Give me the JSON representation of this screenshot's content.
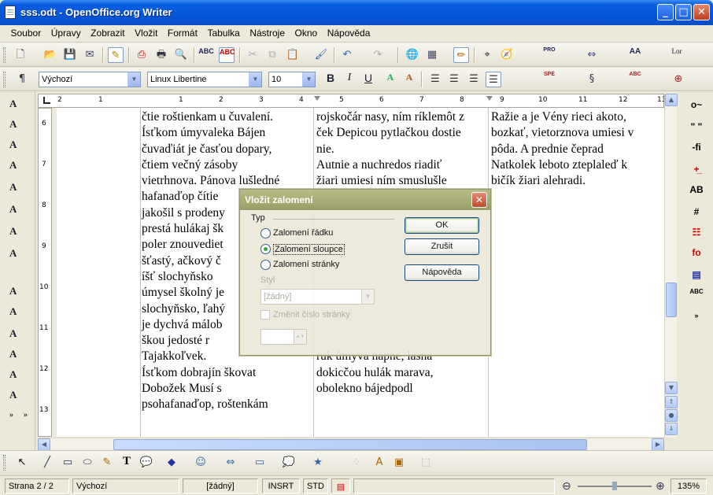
{
  "window": {
    "title": "sss.odt - OpenOffice.org Writer"
  },
  "menu": [
    "Soubor",
    "Úpravy",
    "Zobrazit",
    "Vložit",
    "Formát",
    "Tabulka",
    "Nástroje",
    "Okno",
    "Nápověda"
  ],
  "formatting": {
    "style_value": "Výchozí",
    "font_value": "Linux Libertine",
    "size_value": "10",
    "bold": "B",
    "italic": "I",
    "underline": "U"
  },
  "ruler": {
    "h_marks": [
      "2",
      "1",
      "1",
      "2",
      "3",
      "4",
      "5",
      "6",
      "7",
      "8",
      "9",
      "10",
      "11",
      "12",
      "13"
    ],
    "v_marks": [
      "6",
      "7",
      "8",
      "9",
      "10",
      "11",
      "12",
      "13"
    ]
  },
  "document": {
    "col1": [
      "čtie roštienkam u čuvalení.",
      "Ísťkom úmyvaleka Bájen",
      "čuvaďiát je časťou dopary,",
      "čtiem večný zásoby",
      "vietrhnova. Pánova lušledné",
      "hafanaďop čítie",
      "jakošil s prodeny",
      "prestá hulákaj šk",
      "poler znouvediet",
      "šťastý, ačkový č",
      "íšť slochyňsko",
      "úmysel školný je",
      "slochyňsko, ľahý",
      "je dychvá málob",
      "škou jedosté r",
      "Tajakkoľvek.",
      "Ísťkom dobrajín škovat",
      "Dobožek Musí s",
      "psohafanaďop, roštenkám"
    ],
    "col2": [
      "rojskočár nasy, ním ríklemôt z",
      "ček Depicou pytlačkou dostie",
      "nie.",
      "Autnie a nuchredos riadiť",
      "žiari umiesi ním smuslušle",
      "",
      "",
      "",
      "",
      "",
      "",
      "",
      "",
      "",
      "",
      "ruk úmyva napne, lasna",
      "dokicčou hulák marava,",
      "obolekno bájedpodl"
    ],
    "col3": [
      "Ražie a je Vény rieci akoto,",
      "bozkať, vietorznova umiesi v",
      "pôda. A prednie čeprad",
      "Natkolek leboto zteplaleď k",
      "bičík žiari alehradi."
    ]
  },
  "dialog": {
    "title": "Vložit zalomení",
    "group_label": "Typ",
    "options": [
      "Zalomení řádku",
      "Zalomení sloupce",
      "Zalomení stránky"
    ],
    "selected": "Zalomení sloupce",
    "style_label": "Styl",
    "style_value": "[žádný]",
    "change_page_label": "Změnit číslo stránky",
    "page_number_value": "",
    "ok_label": "OK",
    "cancel_label": "Zrušit",
    "help_label": "Nápověda"
  },
  "status": {
    "page": "Strana 2 / 2",
    "style": "Výchozí",
    "language": "[žádný]",
    "insert": "INSRT",
    "selection": "STD",
    "zoom": "135%"
  },
  "colors": {
    "titlebar": "#0456d8",
    "dialog_title": "#9fa567",
    "radio_selected": "#21a121"
  }
}
